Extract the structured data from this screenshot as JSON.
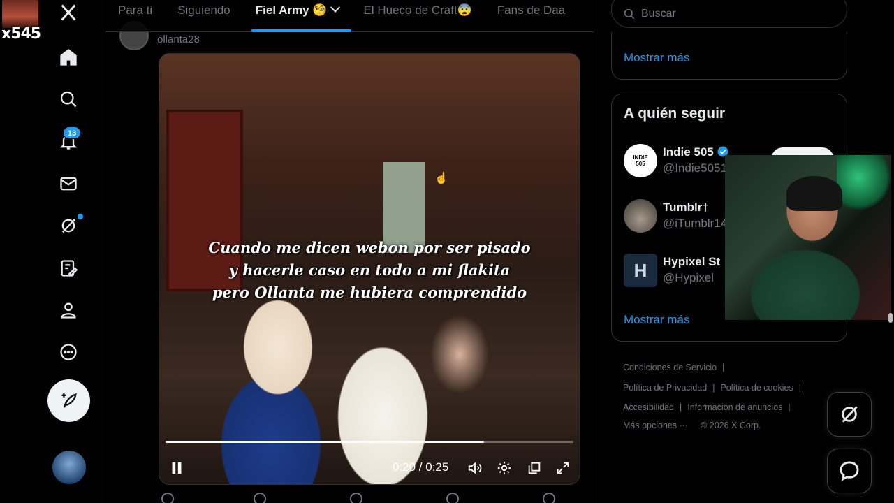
{
  "overlay": {
    "counter": "x545"
  },
  "sidebar": {
    "notifications_count": "13",
    "items": [
      "logo-x",
      "home",
      "explore",
      "notifications",
      "messages",
      "grok",
      "lists",
      "profile",
      "more"
    ]
  },
  "tabs": [
    {
      "label": "Para ti"
    },
    {
      "label": "Siguiendo"
    },
    {
      "label": "Fiel Army 🧐",
      "active": true
    },
    {
      "label": "El Hueco de Craft😨"
    },
    {
      "label": "Fans de Daa"
    }
  ],
  "post": {
    "author_handle": "ollanta28",
    "video": {
      "caption_line1": "Cuando me dicen webon por ser pisado",
      "caption_line2": "y hacerle caso en todo a mi flakita",
      "caption_line3": "pero Ollanta me hubiera comprendido",
      "time": "0:20 / 0:25",
      "progress": 0.78
    }
  },
  "search": {
    "placeholder": "Buscar"
  },
  "trends_card": {
    "show_more": "Mostrar más"
  },
  "who_to_follow": {
    "title": "A quién seguir",
    "accounts": [
      {
        "name": "Indie 505",
        "handle": "@Indie5051",
        "avatar_text": "INDIE 505"
      },
      {
        "name": "Tumblr†",
        "handle": "@iTumblr14"
      },
      {
        "name": "Hypixel St",
        "handle": "@Hypixel",
        "avatar_text": "H"
      }
    ],
    "show_more": "Mostrar más"
  },
  "footer": {
    "terms": "Condiciones de Servicio",
    "privacy": "Política de Privacidad",
    "cookies": "Política de cookies",
    "accessibility": "Accesibilidad",
    "ads_info": "Información de anuncios",
    "more": "Más opciones ···",
    "copyright": "© 2026 X Corp."
  },
  "colors": {
    "accent": "#1d9bf0",
    "background": "#000000",
    "border": "#2f3336",
    "muted": "#71767b"
  }
}
